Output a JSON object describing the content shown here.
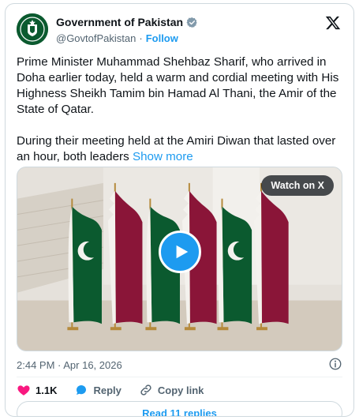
{
  "account": {
    "display_name": "Government of Pakistan",
    "handle": "@GovtofPakistan",
    "separator": "·",
    "follow_label": "Follow"
  },
  "tweet": {
    "paragraph1": "Prime Minister Muhammad Shehbaz Sharif, who arrived in Doha earlier today, held a warm and cordial meeting with His Highness Sheikh Tamim bin Hamad Al Thani, the Amir of the State of Qatar.",
    "paragraph2": "During their meeting held at the Amiri Diwan that lasted over an hour, both leaders",
    "show_more": "Show more"
  },
  "media": {
    "watch_label": "Watch on X"
  },
  "meta": {
    "timestamp": "2:44 PM · Apr 16, 2026"
  },
  "actions": {
    "likes": "1.1K",
    "reply_label": "Reply",
    "copy_link_label": "Copy link"
  },
  "replies": {
    "label": "Read 11 replies"
  },
  "colors": {
    "accent": "#1d9bf0",
    "like": "#f91880",
    "pakistan_green": "#0b5a2f",
    "qatar_maroon": "#8a1538"
  }
}
